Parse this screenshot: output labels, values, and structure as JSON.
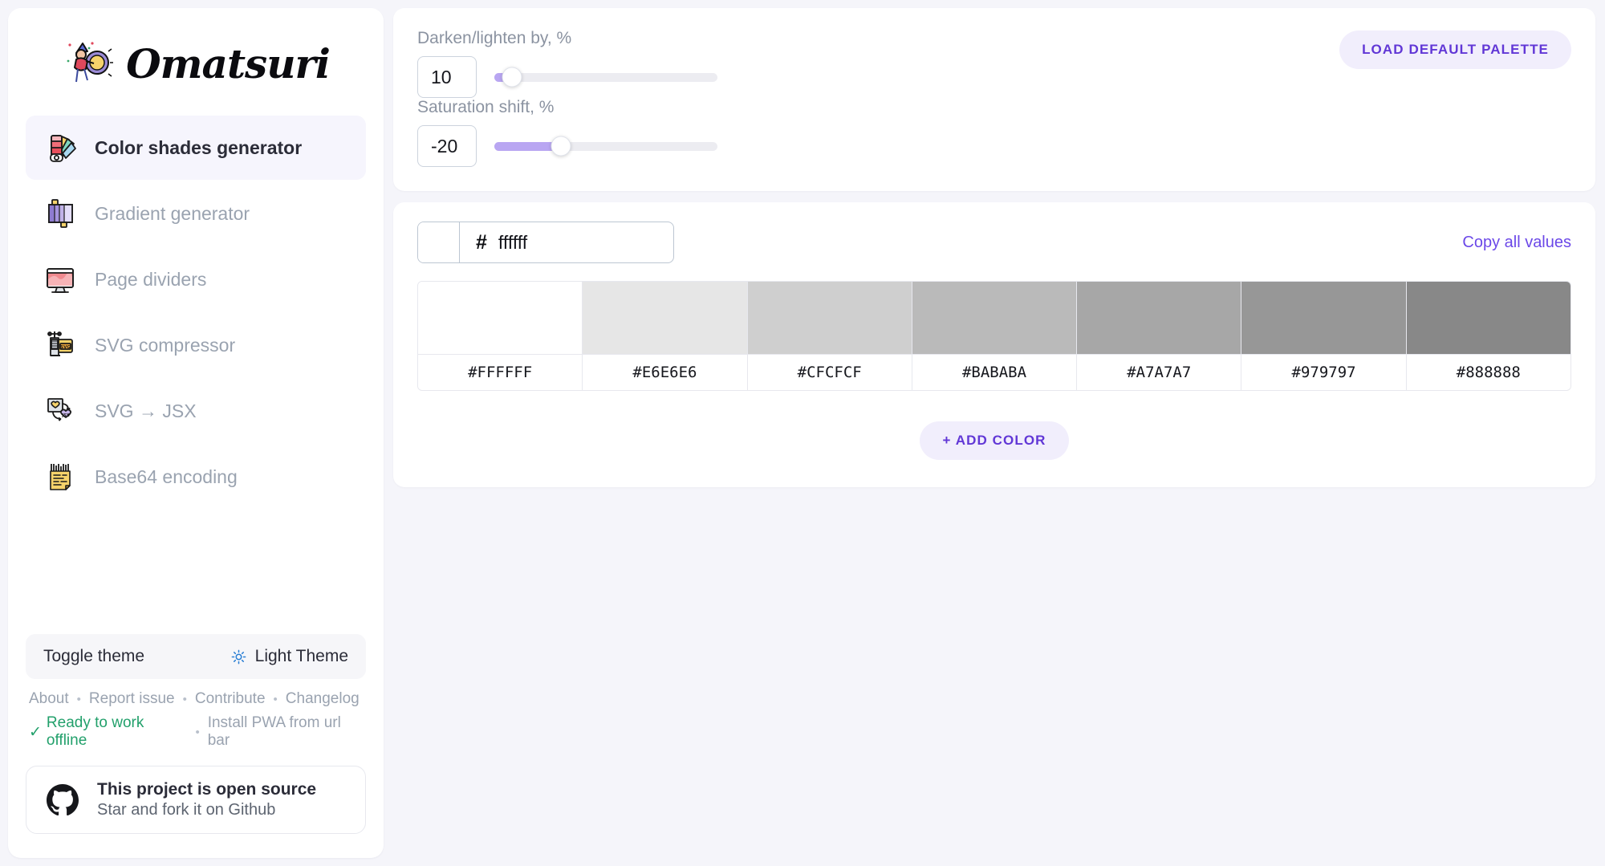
{
  "brand": {
    "name": "Omatsuri",
    "logo_icon": "omatsuri-drummer-logo"
  },
  "sidebar": {
    "items": [
      {
        "label": "Color shades generator",
        "icon": "color-palette-fan-icon",
        "active": true
      },
      {
        "label": "Gradient generator",
        "icon": "gradient-bars-icon",
        "active": false
      },
      {
        "label": "Page dividers",
        "icon": "monitor-wave-icon",
        "active": false
      },
      {
        "label": "SVG compressor",
        "icon": "clamp-svg-icon",
        "active": false
      },
      {
        "label": "SVG → JSX",
        "icon": "svg-to-jsx-heart-icon",
        "active": false
      },
      {
        "label": "Base64 encoding",
        "icon": "barcode-document-icon",
        "active": false
      }
    ],
    "theme_toggle": {
      "label": "Toggle theme",
      "value": "Light Theme",
      "icon": "sun-icon"
    },
    "links": [
      "About",
      "Report issue",
      "Contribute",
      "Changelog"
    ],
    "separator": "•",
    "offline_status": {
      "check": "✓",
      "text": "Ready to work offline"
    },
    "pwa_hint": "Install PWA from url bar",
    "github_card": {
      "title": "This project is open source",
      "subtitle": "Star and fork it on Github",
      "icon": "github-icon"
    }
  },
  "controls": {
    "darken": {
      "label": "Darken/lighten by, %",
      "value": "10",
      "fill_percent": 6,
      "knob_percent": 8
    },
    "saturation": {
      "label": "Saturation shift, %",
      "value": "-20",
      "fill_percent": 30,
      "knob_percent": 30
    },
    "load_default_label": "LOAD DEFAULT PALETTE"
  },
  "palette": {
    "hash": "#",
    "input_value": "ffffff",
    "input_placeholder": "ffffff",
    "swatch_color": "#ffffff",
    "copy_all_label": "Copy all values",
    "add_color_label": "+ ADD COLOR",
    "shades": [
      {
        "hex": "#FFFFFF"
      },
      {
        "hex": "#E6E6E6"
      },
      {
        "hex": "#CFCFCF"
      },
      {
        "hex": "#BABABA"
      },
      {
        "hex": "#A7A7A7"
      },
      {
        "hex": "#979797"
      },
      {
        "hex": "#888888"
      }
    ]
  },
  "colors": {
    "accent": "#6137d6",
    "accent_soft": "#f1eefc",
    "slider_fill": "#b9a6f2",
    "page_bg": "#f5f5fa",
    "success": "#22a06b",
    "link": "#6b48e8"
  }
}
